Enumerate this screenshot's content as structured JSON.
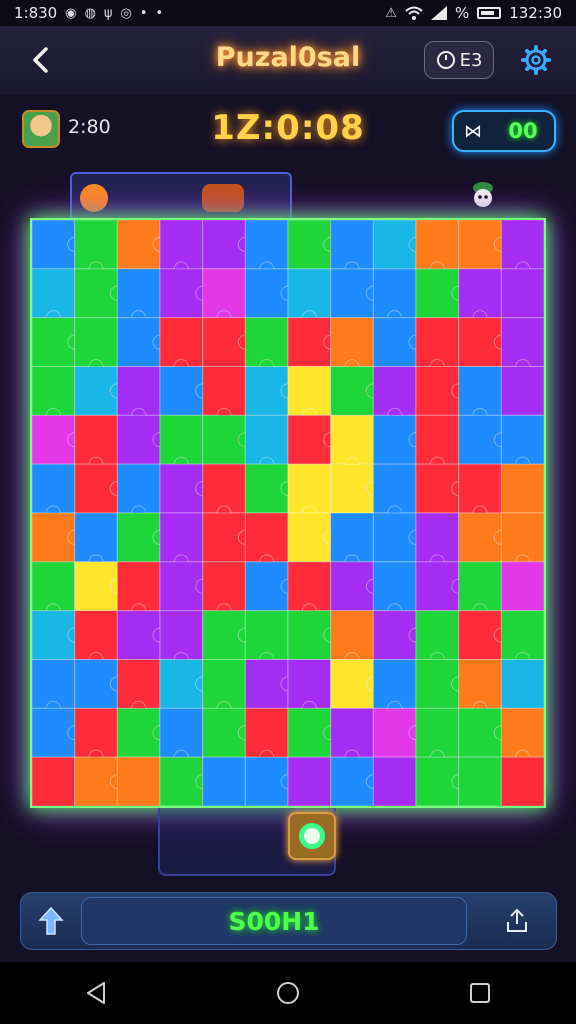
{
  "status_bar": {
    "time_left": "1:830",
    "time_right": "132:30",
    "battery_text": "%",
    "icons": [
      "whatsapp-icon",
      "messenger-icon",
      "usb-icon",
      "chrome-icon",
      "dot-icon",
      "dot-icon",
      "no-sound-icon",
      "wifi-icon",
      "signal-icon",
      "battery-icon"
    ]
  },
  "app_bar": {
    "title": "Puzal0sal",
    "chip_label": "E3",
    "back_icon": "chevron-left-icon",
    "settings_icon": "gear-icon"
  },
  "info_bar": {
    "moves": "2:80",
    "timer": "1Z:0:08",
    "score": "00",
    "score_icon": "bowtie-icon"
  },
  "board": {
    "columns": 12,
    "rows": 12,
    "palette": {
      "R": "#ff2a3a",
      "G": "#1fd63a",
      "B": "#1e8cff",
      "C": "#19b7e6",
      "P": "#a52cf2",
      "M": "#e238e8",
      "Y": "#ffe62a",
      "O": "#ff7a1a",
      "D": "#2a58ff"
    },
    "tiles": [
      "BGOPPBGBCOOP",
      "CGBPMBCBBGPP",
      "GGBRRGROBRRP",
      "GCPBRCYGPRBP",
      "MRPGGCRYBRBB",
      "BRBPRGYYBRRO",
      "OBGPRRYBBPOO",
      "GYRPRBRPBPGM",
      "CRPPGGGOPGRG",
      "BBRCGPPYBGOC",
      "BRGBGRGPMGGO",
      "ROOGBBPBPGGR"
    ]
  },
  "bottom_bar": {
    "main_label": "S00H1",
    "up_icon": "arrow-up-icon",
    "share_icon": "share-icon"
  },
  "nav_bar": {
    "icons": [
      "back-triangle-icon",
      "home-circle-icon",
      "recents-square-icon"
    ]
  }
}
